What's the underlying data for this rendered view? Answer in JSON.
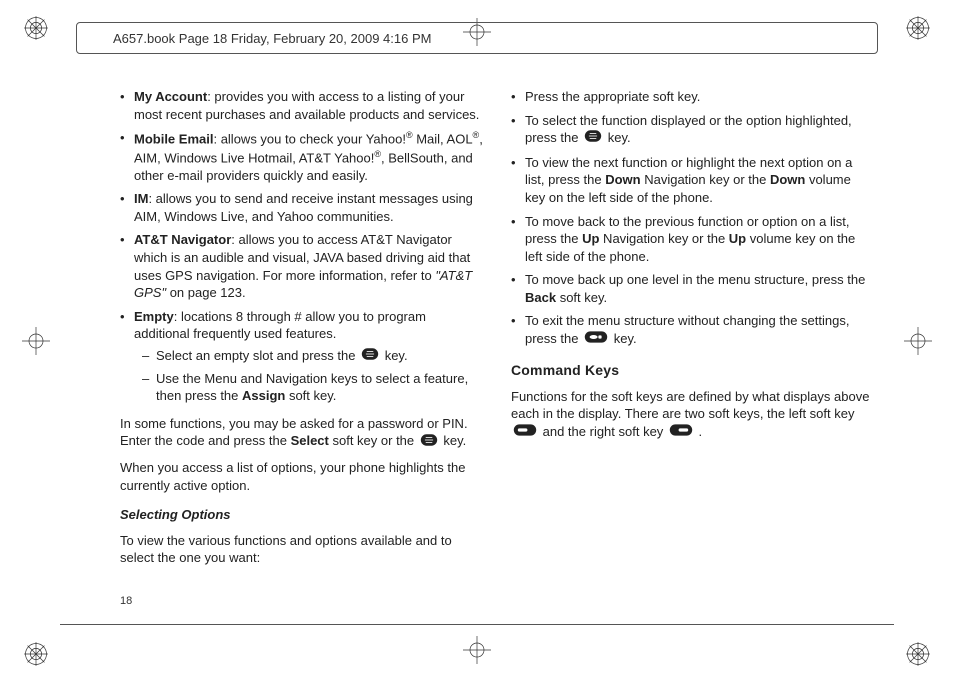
{
  "header": "A657.book  Page 18  Friday, February 20, 2009  4:16 PM",
  "page_number": "18",
  "left": {
    "items": [
      {
        "bold": "My Account",
        "rest": ": provides you with access to a listing of your most recent purchases and available products and services."
      },
      {
        "bold": "Mobile Email",
        "rest": ": allows you to check your Yahoo!",
        "sup1": "®",
        "mid": " Mail, AOL",
        "sup2": "®",
        "mid2": ", AIM, Windows Live Hotmail, AT&T Yahoo!",
        "sup3": "®",
        "tail": ", BellSouth, and other e-mail providers quickly and easily."
      },
      {
        "bold": "IM",
        "rest": ": allows you to send and receive instant messages using AIM, Windows Live, and Yahoo communities."
      },
      {
        "bold": "AT&T Navigator",
        "rest": ": allows you to access AT&T Navigator which is an audible and visual, JAVA based driving aid that uses GPS navigation. For more information, refer to ",
        "ital": "\"AT&T GPS\"",
        "tail2": "  on page 123."
      },
      {
        "bold": "Empty",
        "rest": ": locations 8 through # allow you to program additional frequently used features.",
        "sub": [
          {
            "pre": "Select an empty slot and press the ",
            "post": " key."
          },
          {
            "pre": "Use the Menu and Navigation keys to select a feature, then press the ",
            "b2": "Assign",
            "post2": " soft key."
          }
        ]
      }
    ],
    "para1_a": "In some functions, you may be asked for a password or PIN. Enter the code and press the ",
    "para1_b": "Select",
    "para1_c": " soft key or the ",
    "para1_d": " key.",
    "para2": "When you access a list of options, your phone highlights the currently active option.",
    "subhead": "Selecting Options",
    "para3": "To view the various functions and options available and to select the one you want:"
  },
  "right": {
    "items": [
      {
        "text": "Press the appropriate soft key."
      },
      {
        "pre": "To select the function displayed or the option highlighted, press the ",
        "post": " key."
      },
      {
        "pre": "To view the next function or highlight the next option on a list, press the ",
        "b1": "Down",
        "mid": " Navigation key or the ",
        "b2": "Down",
        "post": " volume key on the left side of the phone."
      },
      {
        "pre": "To move back to the previous function or option on a list, press the ",
        "b1": "Up",
        "mid": " Navigation key or the ",
        "b2": "Up",
        "post": " volume key on the left side of the phone."
      },
      {
        "pre": "To move back up one level in the menu structure, press the ",
        "b1": "Back",
        "post": " soft key."
      },
      {
        "pre": "To exit the menu structure without changing the settings, press the ",
        "post": " key."
      }
    ],
    "head": "Command Keys",
    "para_a": "Functions for the soft keys are defined by what displays above each in the display. There are two soft keys, the left soft key ",
    "para_b": " and the right soft key ",
    "para_c": "."
  }
}
